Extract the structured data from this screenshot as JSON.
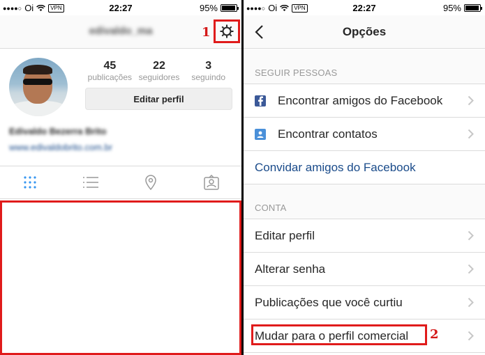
{
  "status_bar": {
    "signal": "●●●●○",
    "carrier": "Oi",
    "vpn": "VPN",
    "time": "22:27",
    "battery": "95%",
    "battery_level": 0.95
  },
  "profile_screen": {
    "username": "edivaldo_ma",
    "stats": [
      {
        "value": "45",
        "label": "publicações"
      },
      {
        "value": "22",
        "label": "seguidores"
      },
      {
        "value": "3",
        "label": "seguindo"
      }
    ],
    "edit_profile_button": "Editar perfil",
    "full_name": "Edivaldo Bezerra Brito",
    "website": "www.edivaldobrito.com.br",
    "tabs": [
      "grid-icon",
      "list-icon",
      "location-pin-icon",
      "tagged-photos-icon"
    ],
    "active_tab_color": "#3897f0",
    "marker_1": "1"
  },
  "options_screen": {
    "title": "Opções",
    "sections": [
      {
        "header": "SEGUIR PESSOAS",
        "items": [
          {
            "label": "Encontrar amigos do Facebook",
            "icon": "facebook-icon"
          },
          {
            "label": "Encontrar contatos",
            "icon": "contacts-icon"
          },
          {
            "label": "Convidar amigos do Facebook",
            "icon": ""
          }
        ]
      },
      {
        "header": "CONTA",
        "items": [
          {
            "label": "Editar perfil"
          },
          {
            "label": "Alterar senha"
          },
          {
            "label": "Publicações que você curtiu"
          },
          {
            "label": "Mudar para o perfil comercial"
          }
        ]
      }
    ],
    "marker_2": "2"
  },
  "colors": {
    "highlight_red": "#e01b1b",
    "facebook_blue": "#3b5998",
    "contacts_blue": "#4a90d9",
    "link_blue": "#1a4b8a"
  }
}
